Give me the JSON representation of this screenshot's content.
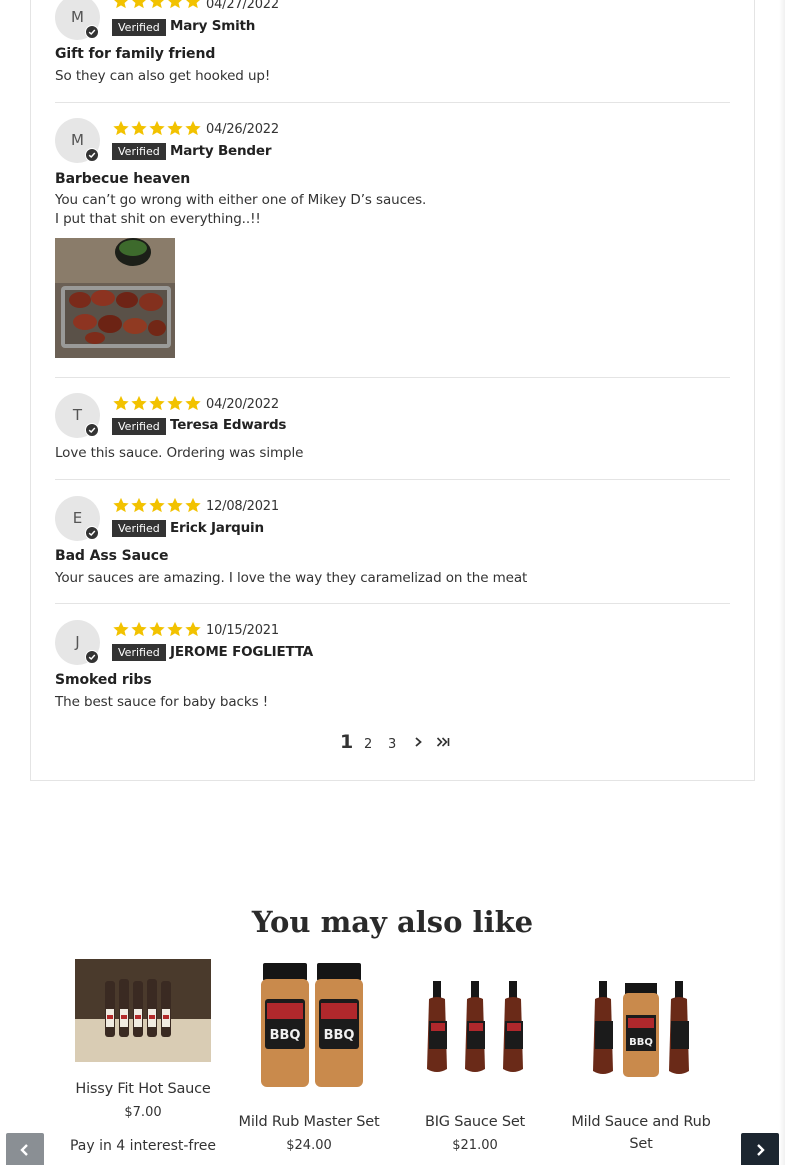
{
  "reviews": [
    {
      "initial": "M",
      "date": "04/27/2022",
      "verified": "Verified",
      "name": "Mary Smith",
      "title": "Gift for family friend",
      "body": [
        "So they can also get hooked up!"
      ],
      "rating": 5
    },
    {
      "initial": "M",
      "date": "04/26/2022",
      "verified": "Verified",
      "name": "Marty Bender",
      "title": "Barbecue heaven",
      "body": [
        "You can’t go wrong with either one of Mikey D’s sauces.",
        "I put that shit on everything..!!"
      ],
      "rating": 5,
      "has_photo": true
    },
    {
      "initial": "T",
      "date": "04/20/2022",
      "verified": "Verified",
      "name": "Teresa Edwards",
      "title": "",
      "body": [
        "Love this sauce. Ordering was simple"
      ],
      "rating": 5
    },
    {
      "initial": "E",
      "date": "12/08/2021",
      "verified": "Verified",
      "name": "Erick Jarquin",
      "title": "Bad Ass Sauce",
      "body": [
        "Your sauces are amazing. I love the way they caramelizad on the meat"
      ],
      "rating": 5
    },
    {
      "initial": "J",
      "date": "10/15/2021",
      "verified": "Verified",
      "name": "JEROME FOGLIETTA",
      "title": "Smoked ribs",
      "body": [
        "The best sauce for baby backs !"
      ],
      "rating": 5
    }
  ],
  "pagination": {
    "current": "1",
    "pages": [
      "2",
      "3"
    ]
  },
  "section_title": "You may also like",
  "products": [
    {
      "name": "Hissy Fit Hot Sauce",
      "price": "$7.00",
      "extra": "Pay in 4 interest-free"
    },
    {
      "name": "Mild Rub Master Set",
      "price": "$24.00"
    },
    {
      "name": "BIG Sauce Set",
      "price": "$21.00"
    },
    {
      "name": "Mild Sauce and Rub Set",
      "name_lines": [
        "Mild Sauce and Rub",
        "Set"
      ]
    }
  ],
  "colors": {
    "star": "#f2c200",
    "badge": "#333333",
    "next_button": "#1c2630",
    "prev_button": "#8a8f94"
  },
  "icons": {
    "star": "star-icon",
    "check": "check-icon",
    "next_page": "chevron-right-icon",
    "last_page": "double-chevron-right-icon",
    "carousel_prev": "chevron-left-icon",
    "carousel_next": "chevron-right-icon"
  }
}
